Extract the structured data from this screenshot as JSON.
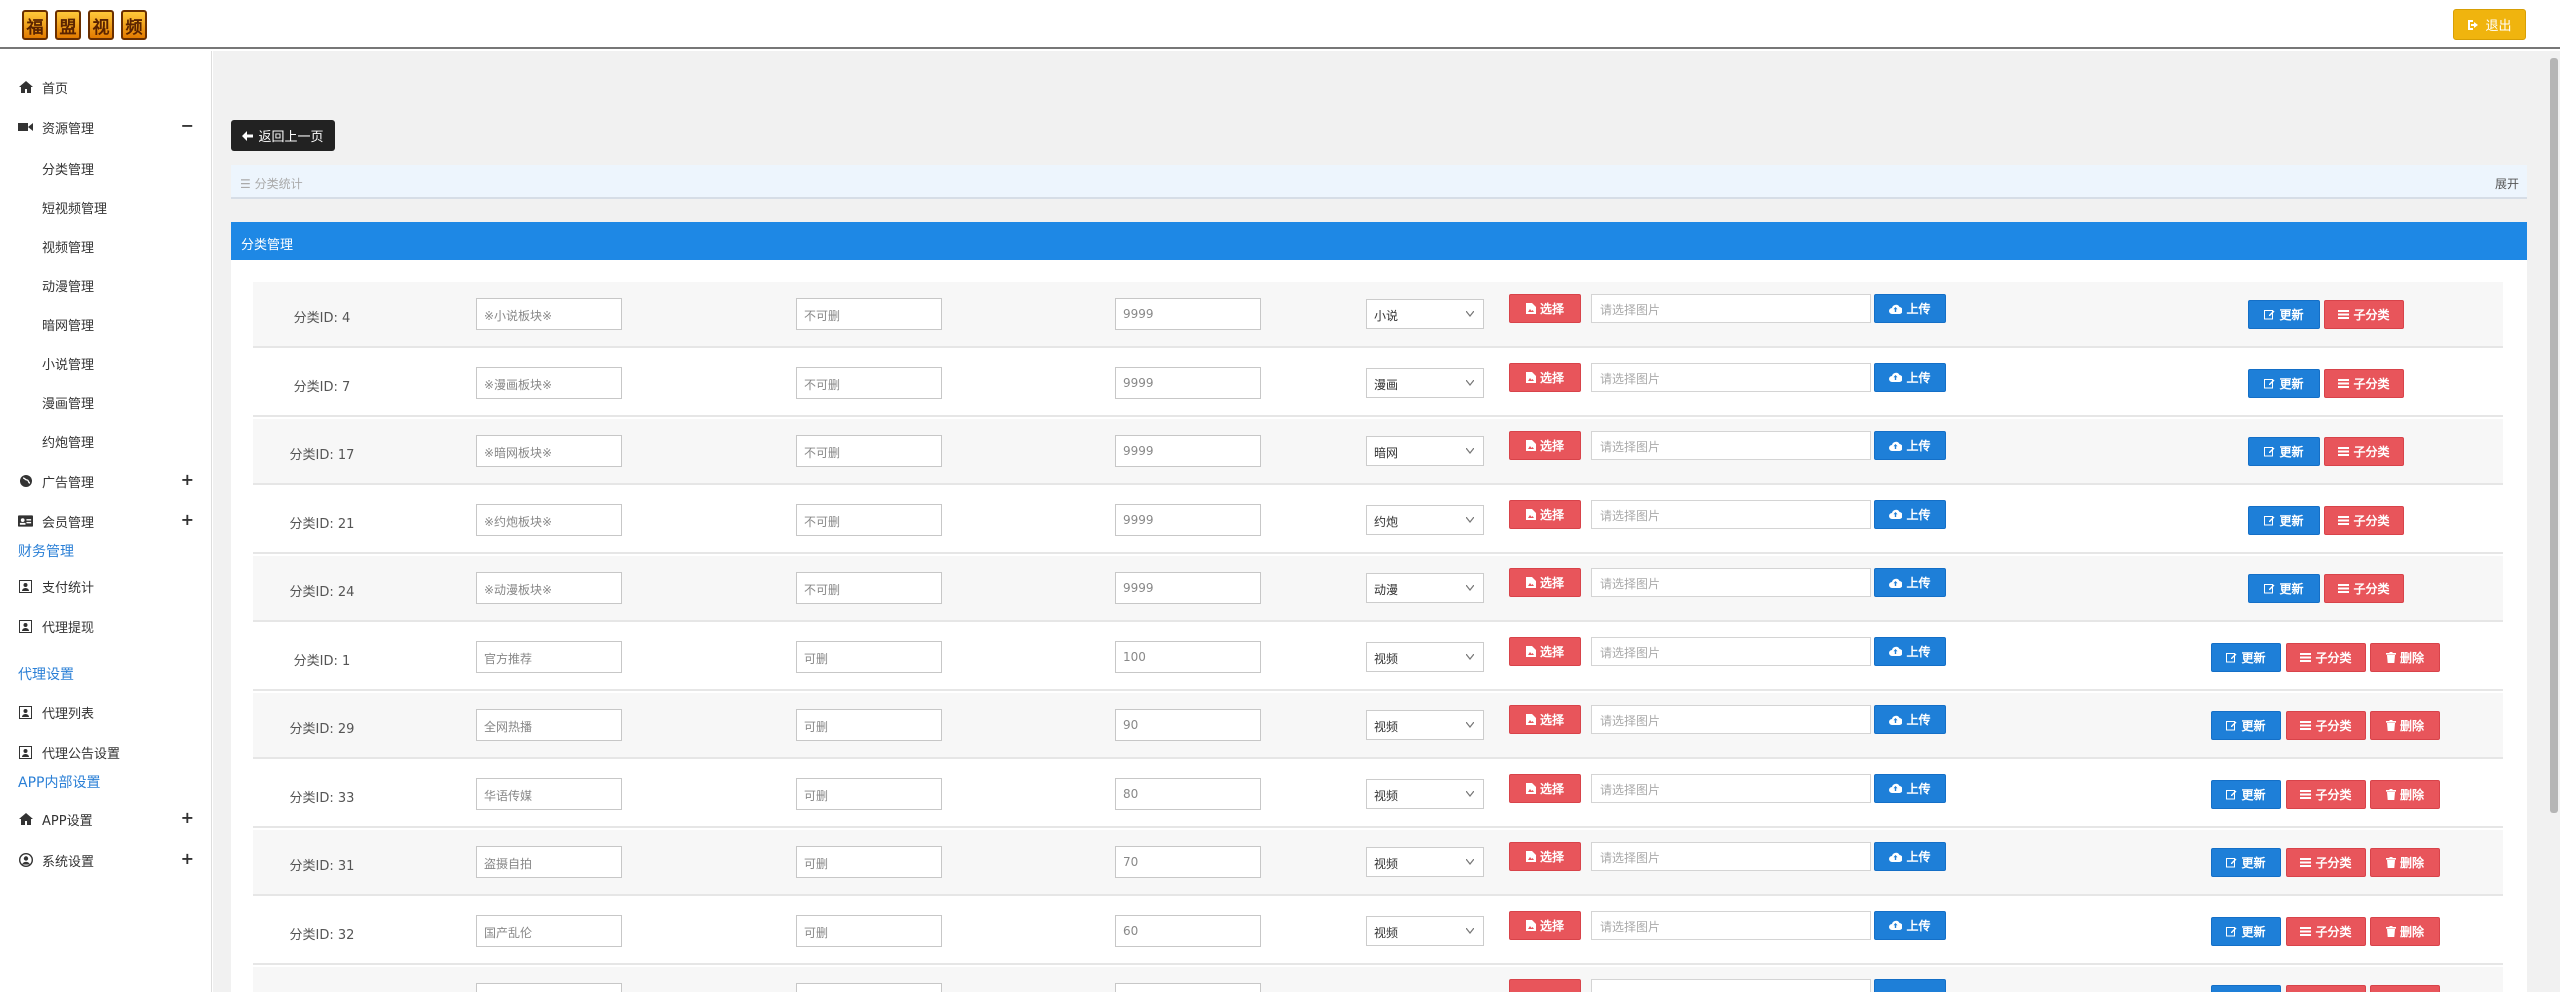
{
  "brand": {
    "logo_chars": [
      "福",
      "盟",
      "视",
      "频"
    ]
  },
  "header": {
    "logout_label": "退出"
  },
  "sidebar": {
    "home": "首页",
    "resources": {
      "label": "资源管理",
      "toggle": "−",
      "items": [
        "分类管理",
        "短视频管理",
        "视频管理",
        "动漫管理",
        "暗网管理",
        "小说管理",
        "漫画管理",
        "约炮管理"
      ]
    },
    "ads": {
      "label": "广告管理",
      "toggle": "+"
    },
    "members": {
      "label": "会员管理",
      "toggle": "+"
    },
    "finance": {
      "section": "财务管理",
      "items": [
        "支付统计",
        "代理提现"
      ]
    },
    "agent": {
      "section": "代理设置",
      "items": [
        "代理列表",
        "代理公告设置"
      ]
    },
    "app_internal": {
      "section": "APP内部设置"
    },
    "app_settings": {
      "label": "APP设置",
      "toggle": "+"
    },
    "system": {
      "label": "系统设置",
      "toggle": "+"
    }
  },
  "main": {
    "back_label": "返回上一页",
    "breadcrumb": "☰ 分类统计",
    "expand_label": "展开",
    "panel_title": "分类管理",
    "buttons": {
      "choose": "选择",
      "upload": "上传",
      "update": "更新",
      "subcat": "子分类",
      "delete": "删除"
    },
    "image_placeholder": "请选择图片",
    "rows": [
      {
        "id": "分类ID: 4",
        "name": "※小说板块※",
        "deletable": "不可删",
        "sort": "9999",
        "type": "小说",
        "can_delete": false
      },
      {
        "id": "分类ID: 7",
        "name": "※漫画板块※",
        "deletable": "不可删",
        "sort": "9999",
        "type": "漫画",
        "can_delete": false
      },
      {
        "id": "分类ID: 17",
        "name": "※暗网板块※",
        "deletable": "不可删",
        "sort": "9999",
        "type": "暗网",
        "can_delete": false
      },
      {
        "id": "分类ID: 21",
        "name": "※约炮板块※",
        "deletable": "不可删",
        "sort": "9999",
        "type": "约炮",
        "can_delete": false
      },
      {
        "id": "分类ID: 24",
        "name": "※动漫板块※",
        "deletable": "不可删",
        "sort": "9999",
        "type": "动漫",
        "can_delete": false
      },
      {
        "id": "分类ID: 1",
        "name": "官方推荐",
        "deletable": "可删",
        "sort": "100",
        "type": "视频",
        "can_delete": true
      },
      {
        "id": "分类ID: 29",
        "name": "全网热播",
        "deletable": "可删",
        "sort": "90",
        "type": "视频",
        "can_delete": true
      },
      {
        "id": "分类ID: 33",
        "name": "华语传媒",
        "deletable": "可删",
        "sort": "80",
        "type": "视频",
        "can_delete": true
      },
      {
        "id": "分类ID: 31",
        "name": "盗摄自拍",
        "deletable": "可删",
        "sort": "70",
        "type": "视频",
        "can_delete": true
      },
      {
        "id": "分类ID: 32",
        "name": "国产乱伦",
        "deletable": "可删",
        "sort": "60",
        "type": "视频",
        "can_delete": true
      }
    ]
  }
}
